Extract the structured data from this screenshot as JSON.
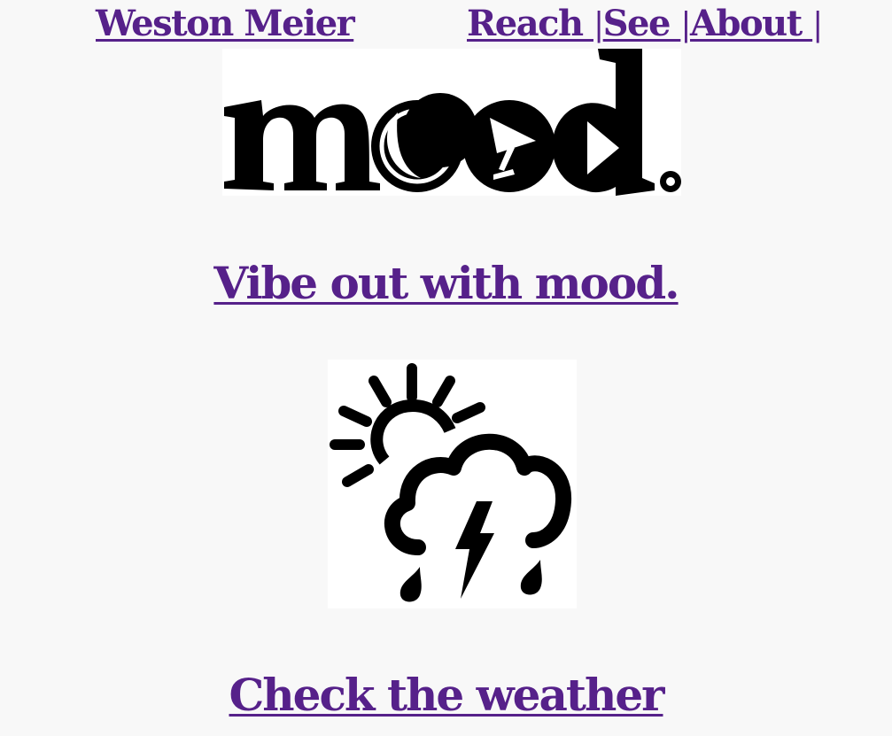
{
  "header": {
    "brand": "Weston Meier",
    "nav": [
      {
        "label": "Reach "
      },
      {
        "label": "See "
      },
      {
        "label": "About "
      }
    ],
    "separator": "|"
  },
  "main": {
    "logo": {
      "text": "mood."
    },
    "mood_link": "Vibe out with mood.",
    "weather_icon": "weather-storm-icon",
    "weather_link": "Check the weather"
  },
  "colors": {
    "link": "#56218a",
    "background": "#f8f8f8"
  }
}
